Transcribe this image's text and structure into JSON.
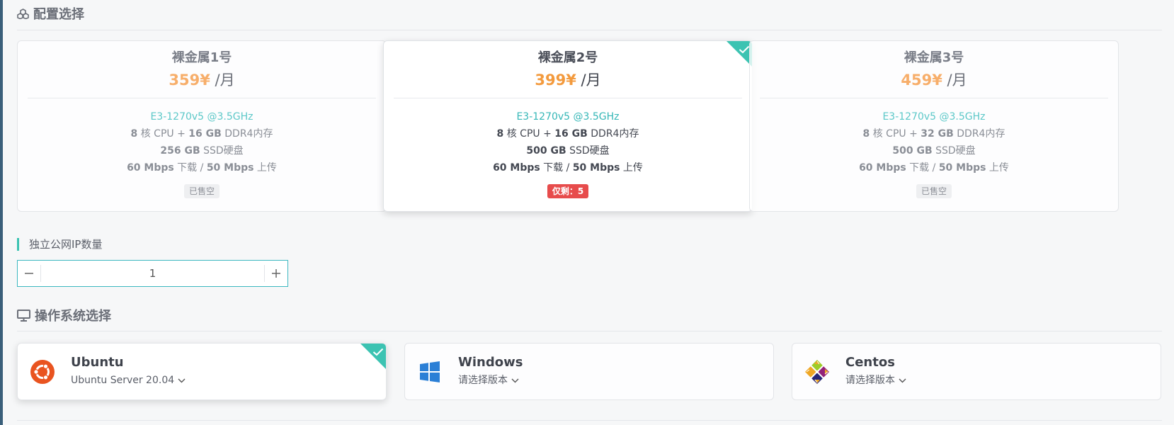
{
  "sections": {
    "config_title": "配置选择",
    "ip_label": "独立公网IP数量",
    "os_title": "操作系统选择"
  },
  "plans": [
    {
      "name": "裸金属1号",
      "price": "359¥",
      "unit": " /月",
      "cpu": "E3-1270v5 @3.5GHz",
      "cores": "8",
      "cores_unit": " 核 CPU + ",
      "ram": "16 GB",
      "ram_unit": " DDR4内存",
      "disk": "256 GB",
      "disk_unit": " SSD硬盘",
      "down": "60 Mbps",
      "down_unit": " 下载 / ",
      "up": "50 Mbps",
      "up_unit": " 上传",
      "badge": "已售空",
      "selected": false
    },
    {
      "name": "裸金属2号",
      "price": "399¥",
      "unit": " /月",
      "cpu": "E3-1270v5 @3.5GHz",
      "cores": "8",
      "cores_unit": " 核 CPU + ",
      "ram": "16 GB",
      "ram_unit": " DDR4内存",
      "disk": "500 GB",
      "disk_unit": " SSD硬盘",
      "down": "60 Mbps",
      "down_unit": " 下载 / ",
      "up": "50 Mbps",
      "up_unit": " 上传",
      "badge": "仅剩：5",
      "selected": true
    },
    {
      "name": "裸金属3号",
      "price": "459¥",
      "unit": " /月",
      "cpu": "E3-1270v5 @3.5GHz",
      "cores": "8",
      "cores_unit": " 核 CPU + ",
      "ram": "32 GB",
      "ram_unit": " DDR4内存",
      "disk": "500 GB",
      "disk_unit": " SSD硬盘",
      "down": "60 Mbps",
      "down_unit": " 下载 / ",
      "up": "50 Mbps",
      "up_unit": " 上传",
      "badge": "已售空",
      "selected": false
    }
  ],
  "ip_counter": {
    "value": "1",
    "minus": "−",
    "plus": "+"
  },
  "os": [
    {
      "name": "Ubuntu",
      "version": "Ubuntu Server 20.04",
      "icon": "ubuntu-logo-icon",
      "selected": true
    },
    {
      "name": "Windows",
      "version": "请选择版本",
      "icon": "windows-logo-icon",
      "selected": false
    },
    {
      "name": "Centos",
      "version": "请选择版本",
      "icon": "centos-logo-icon",
      "selected": false
    }
  ],
  "colors": {
    "accent": "#3cc3b2",
    "price": "#f39a3d",
    "cpu": "#35b7b7",
    "remain_badge": "#e74c4c"
  }
}
